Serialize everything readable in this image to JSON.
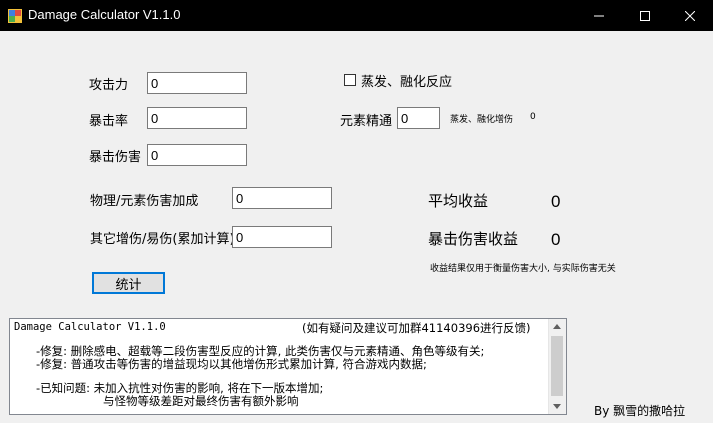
{
  "window": {
    "title": "Damage Calculator V1.1.0"
  },
  "form": {
    "attack_label": "攻击力",
    "attack_value": "0",
    "crit_rate_label": "暴击率",
    "crit_rate_value": "0",
    "crit_damage_label": "暴击伤害",
    "crit_damage_value": "0",
    "bonus_label": "物理/元素伤害加成",
    "bonus_value": "0",
    "other_label": "其它增伤/易伤(累加计算)",
    "other_value": "0",
    "reaction_checkbox_label": "蒸发、融化反应",
    "reaction_checked": false,
    "em_label": "元素精通",
    "em_value": "0",
    "reaction_bonus_label": "蒸发、融化增伤",
    "reaction_bonus_value": "0",
    "calc_button": "统计"
  },
  "results": {
    "avg_label": "平均收益",
    "avg_value": "0",
    "crit_label": "暴击伤害收益",
    "crit_value": "0",
    "note": "收益结果仅用于衡量伤害大小, 与实际伤害无关"
  },
  "info_box": {
    "header_left": "Damage Calculator V1.1.0",
    "header_right": "(如有疑问及建议可加群41140396进行反馈)",
    "fix1": "-修复: 删除感电、超载等二段伤害型反应的计算, 此类伤害仅与元素精通、角色等级有关;",
    "fix2": "-修复: 普通攻击等伤害的增益现均以其他增伤形式累加计算, 符合游戏内数据;",
    "known1": "-已知问题: 未加入抗性对伤害的影响, 将在下一版本增加;",
    "known2": "与怪物等级差距对最终伤害有额外影响"
  },
  "byline": "By  飘雪的撒哈拉",
  "colors": {
    "titlebar": "#000000",
    "window_bg": "#f0f0f0",
    "button_border": "#0078d7"
  }
}
